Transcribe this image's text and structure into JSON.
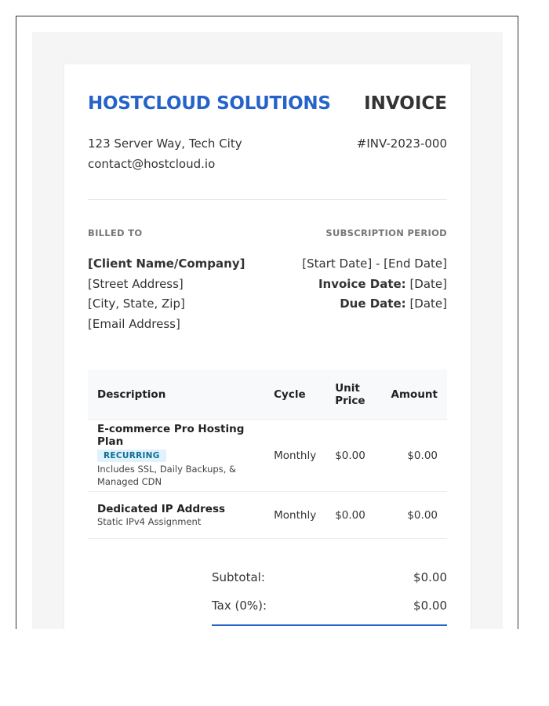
{
  "company": {
    "name": "HOSTCLOUD SOLUTIONS",
    "address": "123 Server Way, Tech City",
    "email": "contact@hostcloud.io"
  },
  "invoice": {
    "title": "INVOICE",
    "number": "#INV-2023-000"
  },
  "billed_to": {
    "label": "BILLED TO",
    "name": "[Client Name/Company]",
    "street": "[Street Address]",
    "city": "[City, State, Zip]",
    "email": "[Email Address]"
  },
  "subscription": {
    "label": "SUBSCRIPTION PERIOD",
    "period": "[Start Date] - [End Date]",
    "invoice_date_label": "Invoice Date:",
    "invoice_date": "[Date]",
    "due_date_label": "Due Date:",
    "due_date": "[Date]"
  },
  "table": {
    "headers": {
      "description": "Description",
      "cycle": "Cycle",
      "unit_price": "Unit Price",
      "amount": "Amount"
    },
    "rows": [
      {
        "name": "E-commerce Pro Hosting Plan",
        "badge": "RECURRING",
        "description": "Includes SSL, Daily Backups, & Managed CDN",
        "cycle": "Monthly",
        "unit_price": "$0.00",
        "amount": "$0.00"
      },
      {
        "name": "Dedicated IP Address",
        "description": "Static IPv4 Assignment",
        "cycle": "Monthly",
        "unit_price": "$0.00",
        "amount": "$0.00"
      }
    ]
  },
  "totals": {
    "subtotal_label": "Subtotal:",
    "subtotal": "$0.00",
    "tax_label": "Tax (0%):",
    "tax": "$0.00"
  },
  "colors": {
    "brand": "#2563c9",
    "badge_bg": "#e0f2fb",
    "badge_text": "#0e6e96"
  }
}
